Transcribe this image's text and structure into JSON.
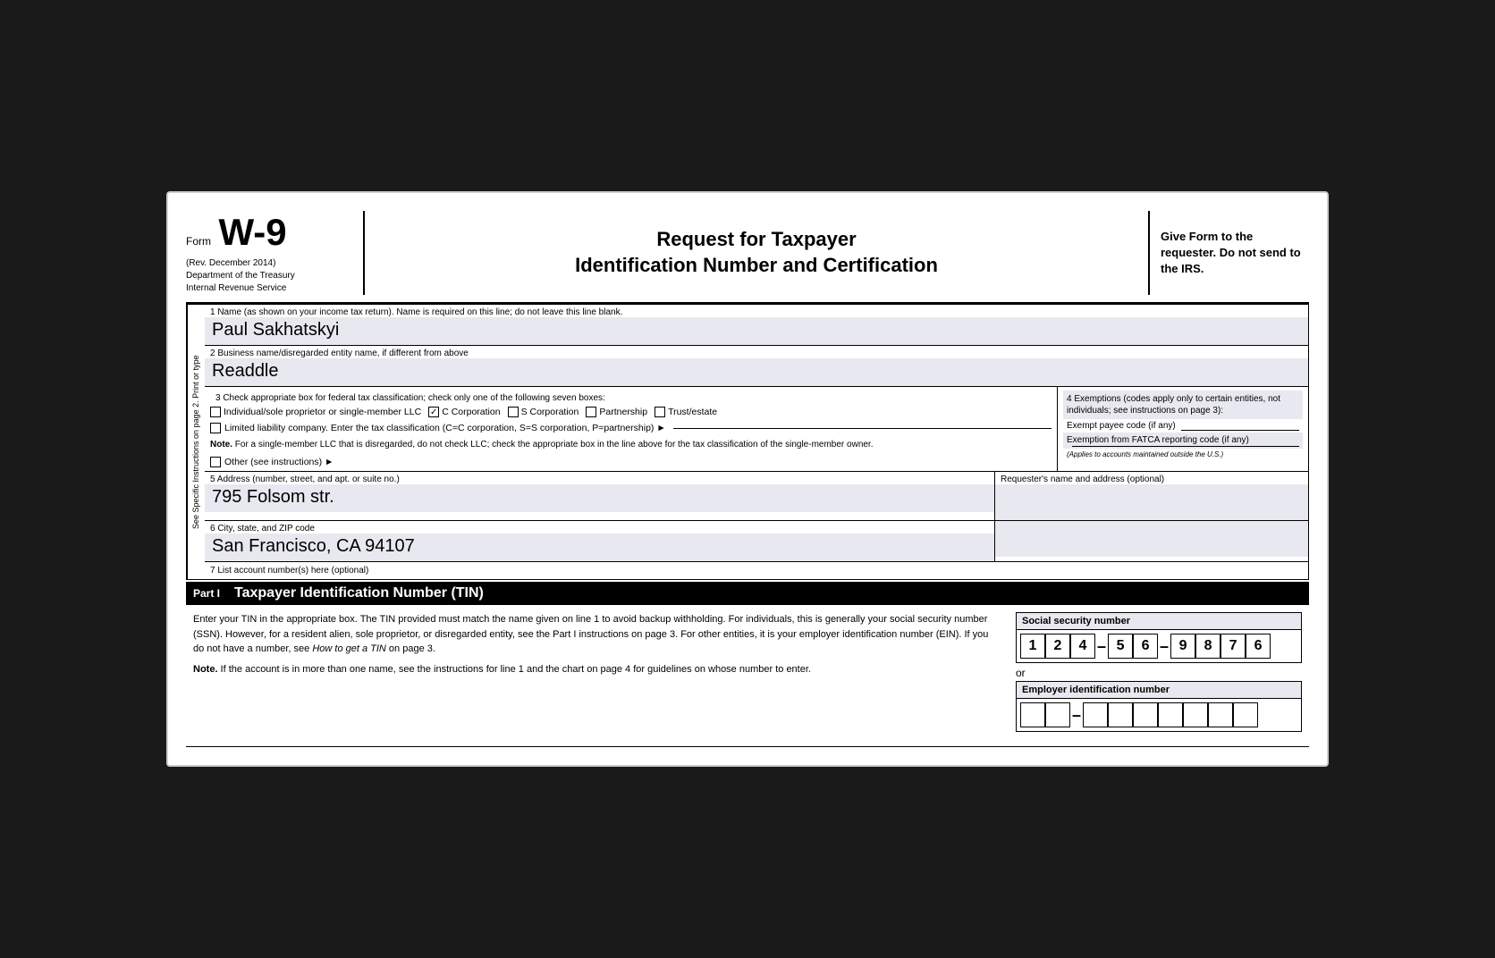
{
  "header": {
    "form_label": "Form",
    "form_number": "W-9",
    "rev": "(Rev. December 2014)",
    "dept": "Department of the Treasury",
    "irs": "Internal Revenue Service",
    "title_line1": "Request for Taxpayer",
    "title_line2": "Identification Number and Certification",
    "give_form": "Give Form to the requester. Do not send to the IRS."
  },
  "sidebar": {
    "text": "See Specific Instructions on page 2.  Print or type"
  },
  "fields": {
    "field1_label": "1  Name (as shown on your income tax return). Name is required on this line; do not leave this line blank.",
    "field1_value": "Paul Sakhatskyi",
    "field2_label": "2  Business name/disregarded entity name, if different from above",
    "field2_value": "Readdle",
    "field3_label": "3  Check appropriate box for federal tax classification; check only one of the following seven boxes:",
    "individual_label": "Individual/sole proprietor or single-member LLC",
    "c_corp_label": "C Corporation",
    "s_corp_label": "S Corporation",
    "partnership_label": "Partnership",
    "trust_label": "Trust/estate",
    "llc_label": "Limited liability company. Enter the tax classification (C=C corporation, S=S corporation, P=partnership) ►",
    "note_label": "Note.",
    "note_text": "For a single-member LLC that is disregarded, do not check LLC; check the appropriate box in the line above for the tax classification of the single-member owner.",
    "other_label": "Other (see instructions) ►",
    "field4_label": "4  Exemptions (codes apply only to certain entities, not individuals; see instructions on page 3):",
    "exempt_payee_label": "Exempt payee code (if any)",
    "fatca_label": "Exemption from FATCA reporting code (if any)",
    "applies_text": "(Applies to accounts maintained outside the U.S.)",
    "field5_label": "5  Address (number, street, and apt. or suite no.)",
    "field5_value": "795 Folsom str.",
    "field5_right_label": "Requester's name and address (optional)",
    "field6_label": "6  City, state, and ZIP code",
    "field6_value": "San Francisco, CA 94107",
    "field7_label": "7  List account number(s) here (optional)"
  },
  "part1": {
    "label": "Part I",
    "title": "Taxpayer Identification Number (TIN)",
    "text1": "Enter your TIN in the appropriate box. The TIN provided must match the name given on line 1 to avoid backup withholding. For individuals, this is generally your social security number (SSN). However, for a resident alien, sole proprietor, or disregarded entity, see the Part I instructions on page 3. For other entities, it is your employer identification number (EIN). If you do not have a number, see How to get a TIN on page 3.",
    "text2": "Note. If the account is in more than one name, see the instructions for line 1 and the chart on page 4 for guidelines on whose number to enter.",
    "ssn_label": "Social security number",
    "ssn_digits": [
      "1",
      "2",
      "4",
      "5",
      "6",
      "9",
      "8",
      "7",
      "6"
    ],
    "or_text": "or",
    "ein_label": "Employer identification number",
    "ein_digits": [
      "",
      "",
      "",
      "",
      "",
      "",
      "",
      "",
      ""
    ]
  }
}
